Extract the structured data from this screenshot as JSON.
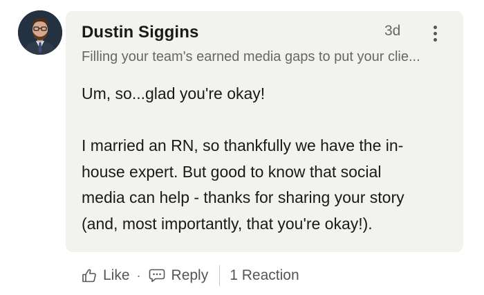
{
  "comment": {
    "author": {
      "name": "Dustin Siggins",
      "headline": "Filling your team's earned media gaps to put your clie..."
    },
    "timestamp": "3d",
    "more_icon": "vertical-ellipsis",
    "text": "Um, so...glad you're okay!\n\nI married an RN, so thankfully we have the in-\nhouse expert. But good to know that social\nmedia can help - thanks for sharing your story\n(and, most importantly, that you're okay!)."
  },
  "actions": {
    "like_label": "Like",
    "like_icon": "thumbs-up-outline",
    "separator": "·",
    "reply_label": "Reply",
    "reply_icon": "speech-bubble-outline",
    "reactions_label": "1 Reaction"
  },
  "colors": {
    "bubble_background": "#f2f2ee",
    "primary_text": "#191919",
    "secondary_text": "#666666"
  }
}
